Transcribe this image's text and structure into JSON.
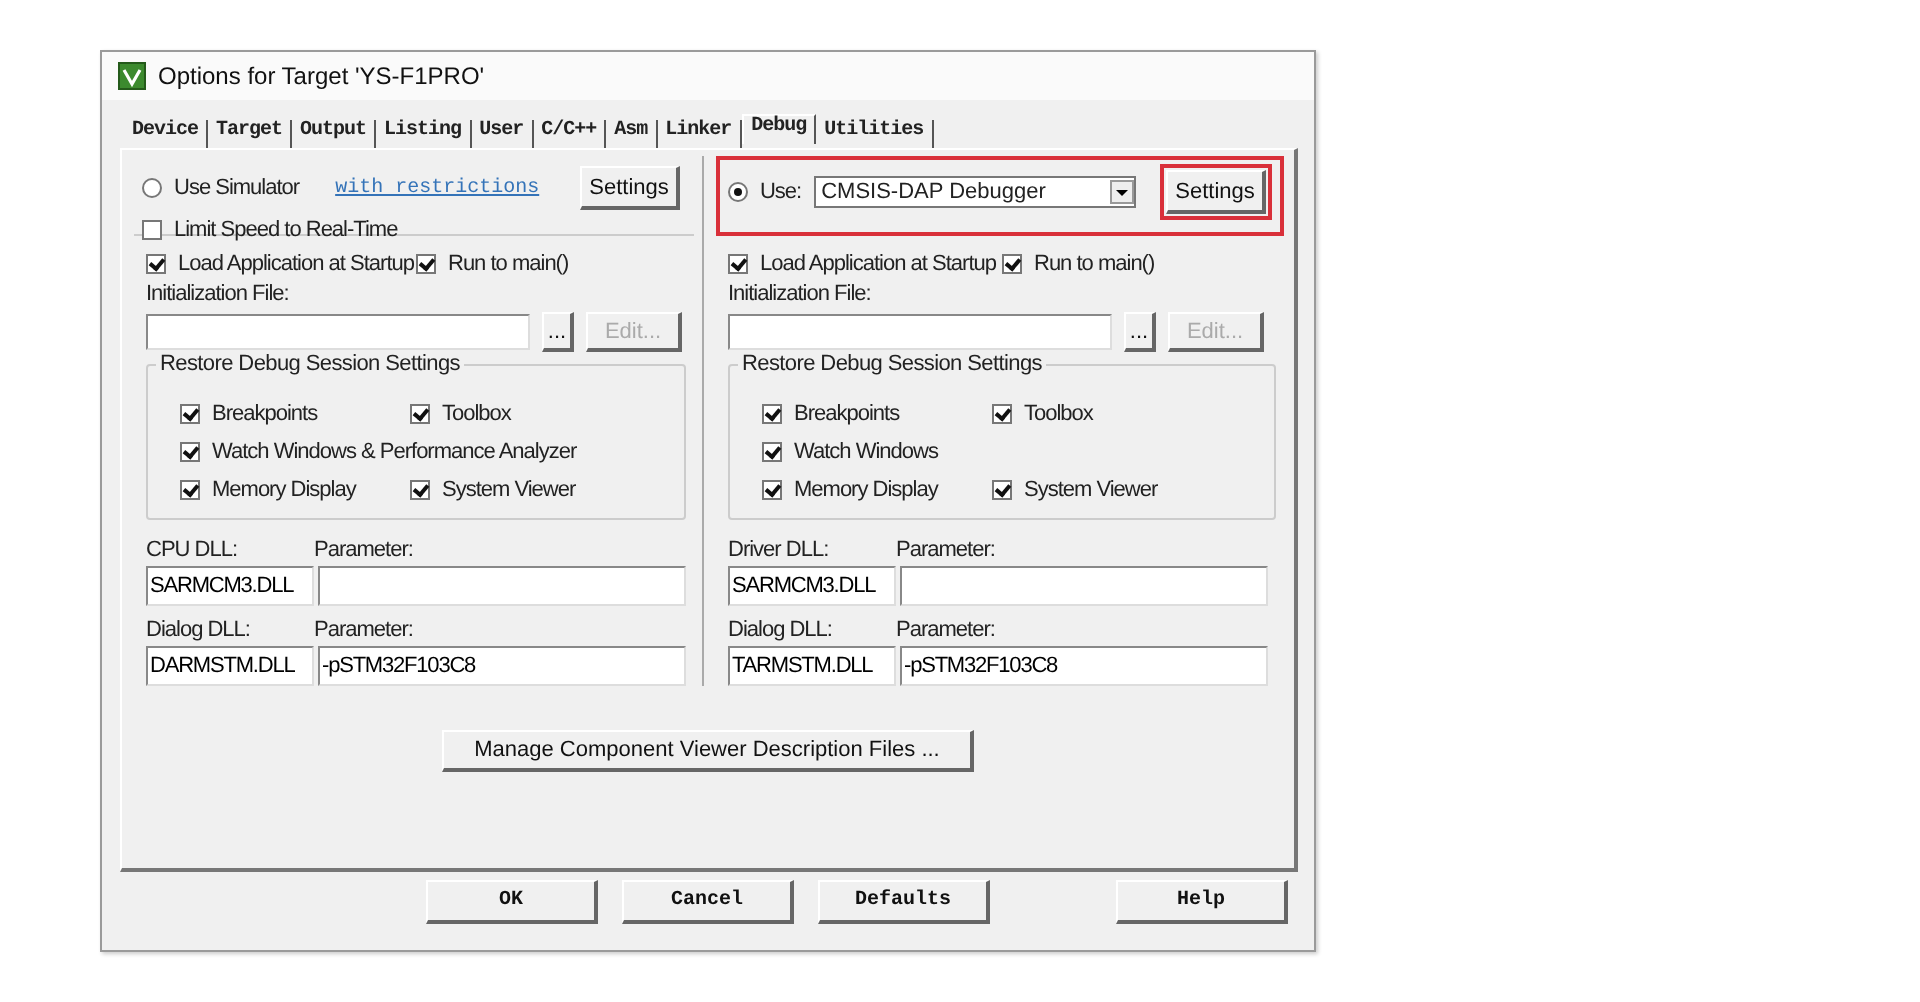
{
  "window": {
    "title": "Options for Target 'YS-F1PRO'"
  },
  "tabs": [
    {
      "label": "Device",
      "selected": false
    },
    {
      "label": "Target",
      "selected": false
    },
    {
      "label": "Output",
      "selected": false
    },
    {
      "label": "Listing",
      "selected": false
    },
    {
      "label": "User",
      "selected": false
    },
    {
      "label": "C/C++",
      "selected": false
    },
    {
      "label": "Asm",
      "selected": false
    },
    {
      "label": "Linker",
      "selected": false
    },
    {
      "label": "Debug",
      "selected": true
    },
    {
      "label": "Utilities",
      "selected": false
    }
  ],
  "columns": [
    {
      "mode": {
        "kind": "simulator",
        "label": "Use Simulator",
        "selected": false,
        "link": "with restrictions",
        "button": "Settings",
        "highlighted": false,
        "button_highlighted": false
      },
      "limit": {
        "label": "Limit Speed to Real-Time",
        "checked": false
      },
      "options": [
        {
          "label": "Load Application at Startup",
          "checked": true
        },
        {
          "label": "Run to main()",
          "checked": true
        }
      ],
      "init_label": "Initialization File:",
      "browse": "...",
      "edit": {
        "label": "Edit...",
        "disabled": true
      },
      "restore": {
        "title": "Restore Debug Session Settings",
        "rows": [
          {
            "items": [
              {
                "label": "Breakpoints",
                "checked": true
              },
              {
                "label": "Toolbox",
                "checked": true
              }
            ]
          },
          {
            "items": [
              {
                "label": "Watch Windows & Performance Analyzer",
                "checked": true
              }
            ]
          },
          {
            "items": [
              {
                "label": "Memory Display",
                "checked": true
              },
              {
                "label": "System Viewer",
                "checked": true
              }
            ]
          }
        ]
      },
      "dlls": [
        {
          "label": "CPU DLL:",
          "param_label": "Parameter:",
          "value": "SARMCM3.DLL"
        },
        {
          "label": "Dialog DLL:",
          "param_label": "Parameter:",
          "value": "DARMSTM.DLL",
          "param": "-pSTM32F103C8"
        }
      ]
    },
    {
      "mode": {
        "kind": "target",
        "label": "Use:",
        "selected": true,
        "driver": "CMSIS-DAP Debugger",
        "button": "Settings",
        "highlighted": true,
        "button_highlighted": true
      },
      "options": [
        {
          "label": "Load Application at Startup",
          "checked": true
        },
        {
          "label": "Run to main()",
          "checked": true
        }
      ],
      "init_label": "Initialization File:",
      "browse": "...",
      "edit": {
        "label": "Edit...",
        "disabled": true
      },
      "restore": {
        "title": "Restore Debug Session Settings",
        "rows": [
          {
            "items": [
              {
                "label": "Breakpoints",
                "checked": true
              },
              {
                "label": "Toolbox",
                "checked": true
              }
            ]
          },
          {
            "items": [
              {
                "label": "Watch Windows",
                "checked": true
              }
            ]
          },
          {
            "items": [
              {
                "label": "Memory Display",
                "checked": true
              },
              {
                "label": "System Viewer",
                "checked": true
              }
            ]
          }
        ]
      },
      "dlls": [
        {
          "label": "Driver DLL:",
          "param_label": "Parameter:",
          "value": "SARMCM3.DLL"
        },
        {
          "label": "Dialog DLL:",
          "param_label": "Parameter:",
          "value": "TARMSTM.DLL",
          "param": "-pSTM32F103C8"
        }
      ]
    }
  ],
  "manage_button": "Manage Component Viewer Description Files ...",
  "buttons": [
    {
      "label": "OK",
      "kind": "primary"
    },
    {
      "label": "Cancel",
      "kind": "normal"
    },
    {
      "label": "Defaults",
      "kind": "normal"
    },
    {
      "label": "Help",
      "kind": "help"
    }
  ]
}
